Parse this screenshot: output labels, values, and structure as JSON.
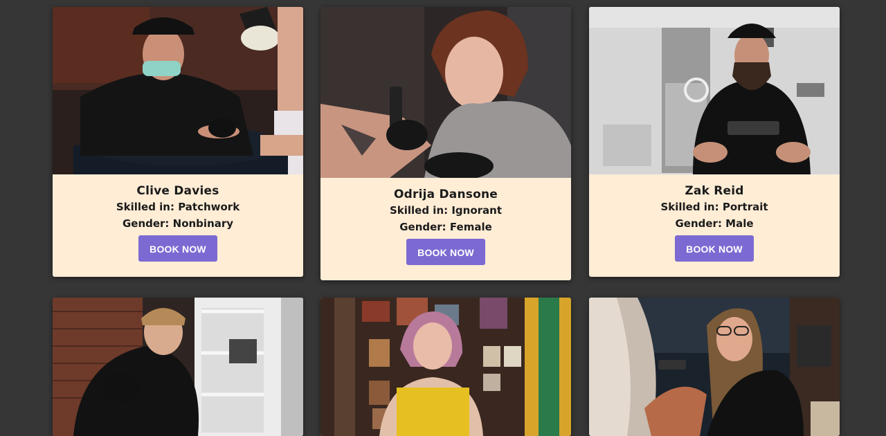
{
  "artists": [
    {
      "name": "Clive Davies",
      "skill": "Skilled in: Patchwork",
      "gender": "Gender: Nonbinary",
      "button": "BOOK NOW"
    },
    {
      "name": "Odrija Dansone",
      "skill": "Skilled in: Ignorant",
      "gender": "Gender: Female",
      "button": "BOOK NOW"
    },
    {
      "name": "Zak Reid",
      "skill": "Skilled in: Portrait",
      "gender": "Gender: Male",
      "button": "BOOK NOW"
    }
  ],
  "colors": {
    "page_background": "#363636",
    "card_background": "#ffedd6",
    "button_background": "#7c6ad2",
    "button_text": "#ffffff",
    "text": "#1b1b1b"
  }
}
